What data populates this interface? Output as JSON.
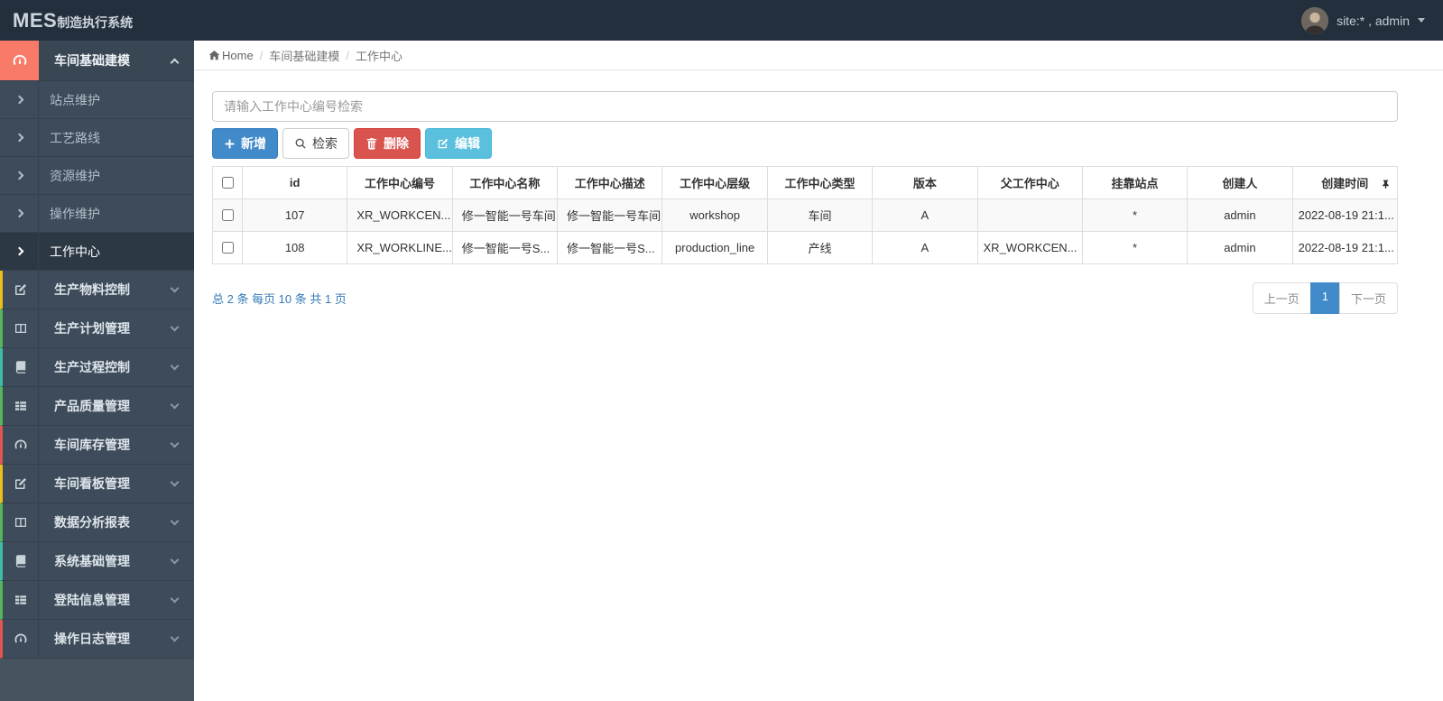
{
  "topbar": {
    "logo_primary": "MES",
    "logo_secondary": "制造执行系统",
    "user_label": "site:* , admin"
  },
  "sidebar": {
    "group": {
      "label": "车间基础建模"
    },
    "submenu": [
      {
        "label": "站点维护"
      },
      {
        "label": "工艺路线"
      },
      {
        "label": "资源维护"
      },
      {
        "label": "操作维护"
      },
      {
        "label": "工作中心",
        "active": true
      }
    ],
    "items": [
      {
        "label": "生产物料控制",
        "icon": "edit-icon",
        "strip": "#e9bf18"
      },
      {
        "label": "生产计划管理",
        "icon": "columns-icon",
        "strip": "#52b75a"
      },
      {
        "label": "生产过程控制",
        "icon": "book-icon",
        "strip": "#3dbda7"
      },
      {
        "label": "产品质量管理",
        "icon": "list-icon",
        "strip": "#52b75a"
      },
      {
        "label": "车间库存管理",
        "icon": "dashboard-icon",
        "strip": "#e0574f"
      },
      {
        "label": "车间看板管理",
        "icon": "edit-icon",
        "strip": "#e9bf18"
      },
      {
        "label": "数据分析报表",
        "icon": "columns-icon",
        "strip": "#52b75a"
      },
      {
        "label": "系统基础管理",
        "icon": "book-icon",
        "strip": "#3dbda7"
      },
      {
        "label": "登陆信息管理",
        "icon": "list-icon",
        "strip": "#52b75a"
      },
      {
        "label": "操作日志管理",
        "icon": "dashboard-icon",
        "strip": "#e0574f"
      }
    ]
  },
  "breadcrumb": {
    "home": "Home",
    "level1": "车间基础建模",
    "level2": "工作中心"
  },
  "search": {
    "placeholder": "请输入工作中心编号检索"
  },
  "toolbar": {
    "add_label": "新增",
    "search_label": "检索",
    "delete_label": "删除",
    "edit_label": "编辑"
  },
  "table": {
    "headers": [
      "id",
      "工作中心编号",
      "工作中心名称",
      "工作中心描述",
      "工作中心层级",
      "工作中心类型",
      "版本",
      "父工作中心",
      "挂靠站点",
      "创建人",
      "创建时间"
    ],
    "rows": [
      [
        "107",
        "XR_WORKCEN...",
        "修一智能一号车间",
        "修一智能一号车间",
        "workshop",
        "车间",
        "A",
        "",
        "*",
        "admin",
        "2022-08-19 21:1..."
      ],
      [
        "108",
        "XR_WORKLINE...",
        "修一智能一号S...",
        "修一智能一号S...",
        "production_line",
        "产线",
        "A",
        "XR_WORKCEN...",
        "*",
        "admin",
        "2022-08-19 21:1..."
      ]
    ]
  },
  "pagination": {
    "summary": "总 2 条  每页 10 条  共 1 页",
    "prev_label": "上一页",
    "page_label": "1",
    "next_label": "下一页"
  },
  "colors": {
    "primary_blue": "#428bca",
    "danger_red": "#d9534f",
    "info_cyan": "#5bc0de",
    "link_blue": "#337ab7",
    "topbar_bg": "#242f3d",
    "sidebar_bg": "#3e4b5a",
    "active_group_icon_bg": "#f87b6a"
  }
}
